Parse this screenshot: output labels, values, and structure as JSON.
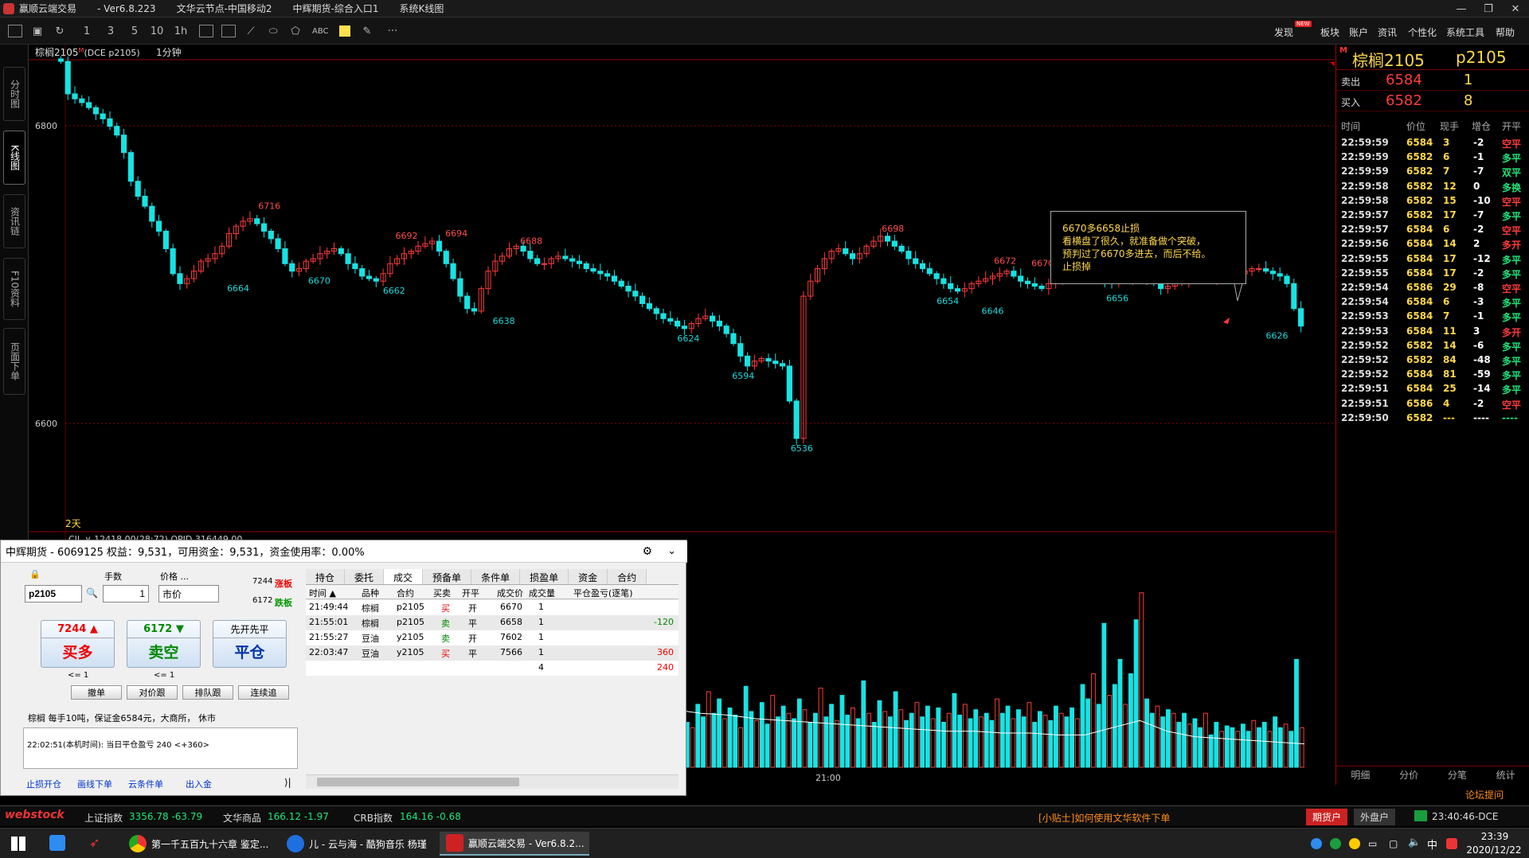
{
  "titlebar": {
    "app": "赢顺云端交易",
    "version": "- Ver6.8.223",
    "server": "文华云节点-中国移动2",
    "broker": "中辉期货-综合入口1",
    "view": "系统K线图"
  },
  "toolbar": {
    "periods": [
      "1",
      "3",
      "5",
      "10",
      "1h"
    ],
    "draw_text": "ABC",
    "more": "···",
    "menu": [
      "发现",
      "板块",
      "账户",
      "资讯",
      "个性化",
      "系统工具",
      "帮助"
    ],
    "new_badge": "NEW"
  },
  "side_tabs": [
    "分时图",
    "K线图",
    "资讯链",
    "F10资料",
    "页面下单"
  ],
  "chart": {
    "header": "棕榈2105",
    "header_mark": "M",
    "header_code": "(DCE p2105)",
    "period_label": "1分钟",
    "y_labels": [
      "6800",
      "6600"
    ],
    "bottom_left_label": "2天",
    "indicator_line": "CJL ∨  12418.00(28:72)  OPID 316449.00",
    "x_time_label": "21:00",
    "colors": {
      "up": "#ff3b3b",
      "down": "#17e3e3",
      "grid": "#8b0000",
      "label_high": "#ff4d4d",
      "label_low": "#1fd9d9"
    }
  },
  "chart_data": {
    "type": "candlestick",
    "title": "棕榈2105 (DCE p2105) 1分钟",
    "ylim": [
      6520,
      6840
    ],
    "annotations_high": [
      {
        "value": 6716,
        "x": 0.17
      },
      {
        "value": 6692,
        "x": 0.28
      },
      {
        "value": 6694,
        "x": 0.32
      },
      {
        "value": 6688,
        "x": 0.38
      },
      {
        "value": 6698,
        "x": 0.67
      },
      {
        "value": 6672,
        "x": 0.76
      },
      {
        "value": 6670,
        "x": 0.79
      },
      {
        "value": 6672,
        "x": 0.925
      }
    ],
    "annotations_low": [
      {
        "value": 6664,
        "x": 0.145
      },
      {
        "value": 6670,
        "x": 0.21
      },
      {
        "value": 6662,
        "x": 0.27
      },
      {
        "value": 6638,
        "x": 0.358
      },
      {
        "value": 6624,
        "x": 0.506
      },
      {
        "value": 6594,
        "x": 0.55
      },
      {
        "value": 6536,
        "x": 0.597
      },
      {
        "value": 6654,
        "x": 0.714
      },
      {
        "value": 6646,
        "x": 0.75
      },
      {
        "value": 6656,
        "x": 0.85
      },
      {
        "value": 6626,
        "x": 0.978
      }
    ],
    "price_path": [
      6838,
      6812,
      6808,
      6805,
      6801,
      6796,
      6792,
      6786,
      6779,
      6765,
      6742,
      6730,
      6722,
      6710,
      6702,
      6688,
      6668,
      6660,
      6664,
      6670,
      6678,
      6680,
      6684,
      6690,
      6700,
      6706,
      6710,
      6712,
      6708,
      6702,
      6696,
      6688,
      6676,
      6670,
      6672,
      6678,
      6680,
      6684,
      6686,
      6688,
      6684,
      6676,
      6672,
      6666,
      6664,
      6662,
      6668,
      6676,
      6680,
      6684,
      6686,
      6690,
      6692,
      6694,
      6686,
      6676,
      6664,
      6650,
      6640,
      6638,
      6656,
      6670,
      6678,
      6682,
      6688,
      6690,
      6686,
      6680,
      6676,
      6676,
      6680,
      6682,
      6680,
      6678,
      6676,
      6672,
      6670,
      6668,
      6666,
      6662,
      6658,
      6654,
      6650,
      6644,
      6640,
      6636,
      6632,
      6630,
      6626,
      6624,
      6628,
      6632,
      6634,
      6630,
      6626,
      6620,
      6612,
      6602,
      6594,
      6598,
      6600,
      6598,
      6596,
      6594,
      6566,
      6536,
      6650,
      6662,
      6672,
      6680,
      6686,
      6688,
      6684,
      6680,
      6684,
      6690,
      6694,
      6698,
      6694,
      6690,
      6686,
      6680,
      6676,
      6672,
      6668,
      6664,
      6660,
      6656,
      6654,
      6656,
      6660,
      6662,
      6664,
      6666,
      6668,
      6670,
      6666,
      6662,
      6660,
      6658,
      6656,
      6660,
      6662,
      6664,
      6666,
      6668,
      6670,
      6668,
      6664,
      6662,
      6660,
      6662,
      6664,
      6666,
      6664,
      6662,
      6660,
      6656,
      6658,
      6660,
      6662,
      6664,
      6666,
      6666,
      6664,
      6664,
      6666,
      6668,
      6668,
      6670,
      6672,
      6672,
      6670,
      6668,
      6666,
      6660,
      6640,
      6626
    ],
    "volume_path": [
      0.18,
      0.32,
      0.25,
      0.22,
      0.35,
      0.28,
      0.42,
      0.3,
      0.38,
      0.27,
      0.33,
      0.29,
      0.22,
      0.45,
      0.31,
      0.26,
      0.36,
      0.24,
      0.4,
      0.28,
      0.34,
      0.3,
      0.27,
      0.38,
      0.32,
      0.25,
      0.3,
      0.44,
      0.28,
      0.35,
      0.26,
      0.4,
      0.29,
      0.33,
      0.27,
      0.48,
      0.3,
      0.25,
      0.37,
      0.31,
      0.28,
      0.42,
      0.32,
      0.26,
      0.3,
      0.36,
      0.28,
      0.34,
      0.27,
      0.33,
      0.25,
      0.3,
      0.41,
      0.29,
      0.35,
      0.27,
      0.32,
      0.28,
      0.3,
      0.26,
      0.38,
      0.3,
      0.34,
      0.27,
      0.32,
      0.28,
      0.36,
      0.25,
      0.31,
      0.29,
      0.26,
      0.34,
      0.3,
      0.28,
      0.33,
      0.27,
      0.46,
      0.38,
      0.52,
      0.35,
      0.8,
      0.4,
      0.46,
      0.6,
      0.35,
      0.52,
      0.82,
      0.97,
      0.38,
      0.3,
      0.34,
      0.28,
      0.32,
      0.3,
      0.25,
      0.3,
      0.24,
      0.27,
      0.22,
      0.3,
      0.18,
      0.25,
      0.2,
      0.23,
      0.22,
      0.2,
      0.24,
      0.2,
      0.26,
      0.22,
      0.25,
      0.2,
      0.28,
      0.22,
      0.24,
      0.2,
      0.6,
      0.22
    ],
    "ma_levels": [
      0.32,
      0.3,
      0.29,
      0.27,
      0.26,
      0.25,
      0.24,
      0.23,
      0.22,
      0.21,
      0.2,
      0.2,
      0.19,
      0.19,
      0.18,
      0.18,
      0.22,
      0.26,
      0.2,
      0.17,
      0.16,
      0.15,
      0.14,
      0.13
    ]
  },
  "annotation": {
    "lines": [
      "6670多6658止损",
      "看横盘了很久，就准备做个突破，",
      "预判过了6670多进去，而后不给。",
      "止损掉"
    ]
  },
  "quote": {
    "mark": "M",
    "name": "棕榈2105",
    "code": "p2105",
    "sell_label": "卖出",
    "sell_price": "6584",
    "sell_qty": "1",
    "buy_label": "买入",
    "buy_price": "6582",
    "buy_qty": "8",
    "headers": [
      "时间",
      "价位",
      "现手",
      "增仓",
      "开平"
    ],
    "ticks": [
      [
        "22:59:59",
        "6584",
        "3",
        "-2",
        "空平",
        "r"
      ],
      [
        "22:59:59",
        "6582",
        "6",
        "-1",
        "多平",
        "g"
      ],
      [
        "22:59:59",
        "6582",
        "7",
        "-7",
        "双平",
        "g"
      ],
      [
        "22:59:58",
        "6582",
        "12",
        "0",
        "多换",
        "g"
      ],
      [
        "22:59:58",
        "6582",
        "15",
        "-10",
        "空平",
        "r"
      ],
      [
        "22:59:57",
        "6582",
        "17",
        "-7",
        "多平",
        "g"
      ],
      [
        "22:59:57",
        "6584",
        "6",
        "-2",
        "空平",
        "r"
      ],
      [
        "22:59:56",
        "6584",
        "14",
        "2",
        "多开",
        "r"
      ],
      [
        "22:59:55",
        "6584",
        "17",
        "-12",
        "多平",
        "g"
      ],
      [
        "22:59:55",
        "6584",
        "17",
        "-2",
        "多平",
        "g"
      ],
      [
        "22:59:54",
        "6586",
        "29",
        "-8",
        "空平",
        "r"
      ],
      [
        "22:59:54",
        "6584",
        "6",
        "-3",
        "多平",
        "g"
      ],
      [
        "22:59:53",
        "6584",
        "7",
        "-1",
        "多平",
        "g"
      ],
      [
        "22:59:53",
        "6584",
        "11",
        "3",
        "多开",
        "r"
      ],
      [
        "22:59:52",
        "6582",
        "14",
        "-6",
        "多平",
        "g"
      ],
      [
        "22:59:52",
        "6582",
        "84",
        "-48",
        "多平",
        "g"
      ],
      [
        "22:59:52",
        "6584",
        "81",
        "-59",
        "多平",
        "g"
      ],
      [
        "22:59:51",
        "6584",
        "25",
        "-14",
        "多平",
        "g"
      ],
      [
        "22:59:51",
        "6586",
        "4",
        "-2",
        "空平",
        "r"
      ],
      [
        "22:59:50",
        "6582",
        "---",
        "----",
        "----",
        "g"
      ]
    ],
    "bottom_tabs": [
      "明细",
      "分价",
      "分笔",
      "统计"
    ]
  },
  "trade": {
    "title": "中辉期货 - 6069125  权益：9,531，可用资金：9,531，资金使用率：0.00%",
    "contract": "p2105",
    "qty_label": "手数",
    "qty": "1",
    "price_label": "价格 ...",
    "price": "市价",
    "limit_up": "7244",
    "limit_up_label": "涨板",
    "limit_down": "6172",
    "limit_down_label": "跌板",
    "buy_price": "7244 ▲",
    "buy_label": "买多",
    "sell_price": "6172 ▼",
    "sell_label": "卖空",
    "close_top": "先开先平",
    "close_label": "平仓",
    "buy_limit": "<= 1",
    "sell_limit": "<= 1",
    "small_buttons": [
      "撤单",
      "对价跟",
      "排队跟",
      "连续追"
    ],
    "info": "棕榈 每手10吨，保证金6584元，大商所， 休市",
    "log": "22:02:51(本机时间): 当日平仓盈亏 240  <+360>",
    "links": [
      "止损开仓",
      "画线下单",
      "云条件单",
      "出入金"
    ],
    "tabs": [
      "持仓",
      "委托",
      "成交",
      "预备单",
      "条件单",
      "损盈单",
      "资金",
      "合约"
    ],
    "grid_headers": [
      "时间 ▲",
      "品种",
      "合约",
      "买卖",
      "开平",
      "成交价",
      "成交量",
      "平仓盈亏(逐笔)"
    ],
    "rows": [
      [
        "21:49:44",
        "棕榈",
        "p2105",
        "买",
        "开",
        "6670",
        "1",
        ""
      ],
      [
        "21:55:01",
        "棕榈",
        "p2105",
        "卖",
        "平",
        "6658",
        "1",
        "-120"
      ],
      [
        "21:55:27",
        "豆油",
        "y2105",
        "卖",
        "开",
        "7602",
        "1",
        ""
      ],
      [
        "22:03:47",
        "豆油",
        "y2105",
        "买",
        "平",
        "7566",
        "1",
        "360"
      ]
    ],
    "total_qty": "4",
    "total_pnl": "240"
  },
  "statusbar": {
    "logo": "webstock",
    "idx1_name": "上证指数",
    "idx1_val": "3356.78  -63.79",
    "idx2_name": "文华商品",
    "idx2_val": "166.12  -1.97",
    "idx3_name": "CRB指数",
    "idx3_val": "164.16  -0.68",
    "tip": "[小贴士]如何使用文华软件下单",
    "acct1": "期货户",
    "acct2": "外盘户",
    "clock": "23:40:46-DCE",
    "forum": "论坛提问"
  },
  "taskbar": {
    "tasks": [
      "第一千五百九十六章 鉴定...",
      "儿 - 云与海 - 酷狗音乐 杨瑾",
      "赢顺云端交易  -  Ver6.8.2..."
    ],
    "time": "23:39",
    "date": "2020/12/22",
    "ime": "中"
  }
}
